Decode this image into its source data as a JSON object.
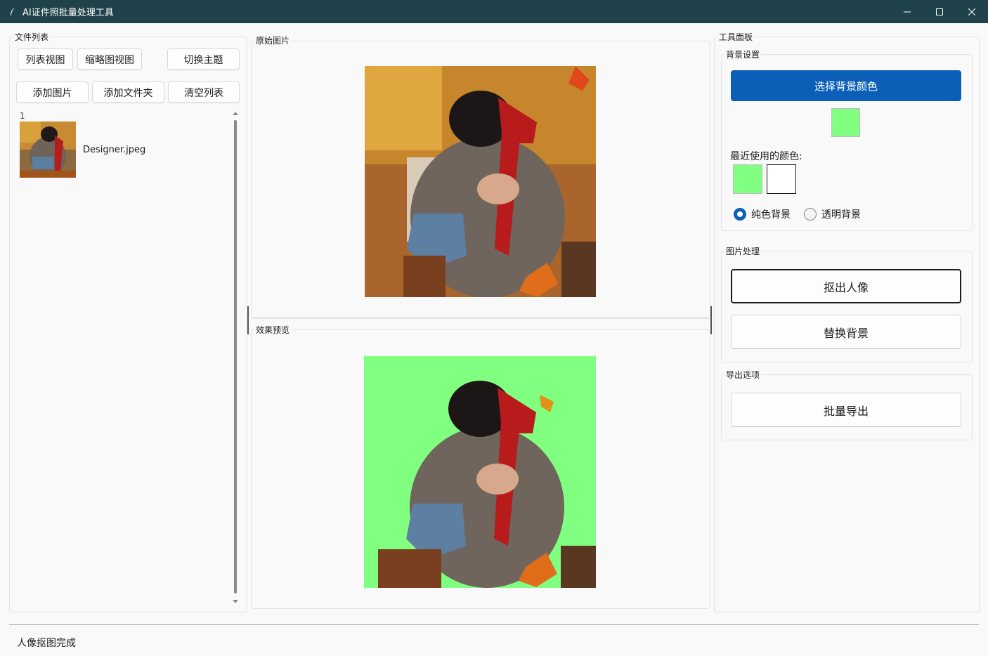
{
  "window": {
    "title": "AI证件照批量处理工具",
    "controls": {
      "minimize": "—",
      "maximize": "☐",
      "close": "✕"
    }
  },
  "file_list": {
    "group_title": "文件列表",
    "view_buttons": [
      "列表视图",
      "缩略图视图",
      "切换主题"
    ],
    "action_buttons": [
      "添加图片",
      "添加文件夹",
      "清空列表"
    ],
    "items": [
      {
        "index": "1",
        "name": "Designer.jpeg"
      }
    ]
  },
  "preview": {
    "original_title": "原始图片",
    "result_title": "效果预览"
  },
  "tools": {
    "group_title": "工具面板",
    "background": {
      "title": "背景设置",
      "choose_color_button": "选择背景颜色",
      "current_color": "#80ff80",
      "recent_label": "最近使用的颜色:",
      "recent_colors": [
        "#80ff80",
        "#ffffff"
      ],
      "radio_solid": "纯色背景",
      "radio_transparent": "透明背景",
      "selected_mode": "纯色背景"
    },
    "processing": {
      "title": "图片处理",
      "cutout_button": "抠出人像",
      "replace_button": "替换背景"
    },
    "export": {
      "title": "导出选项",
      "batch_export_button": "批量导出"
    }
  },
  "status_bar": {
    "text": "人像抠图完成"
  },
  "colors": {
    "titlebar": "#20434b",
    "accent": "#0c5fb7",
    "green_bg": "#80ff80"
  }
}
